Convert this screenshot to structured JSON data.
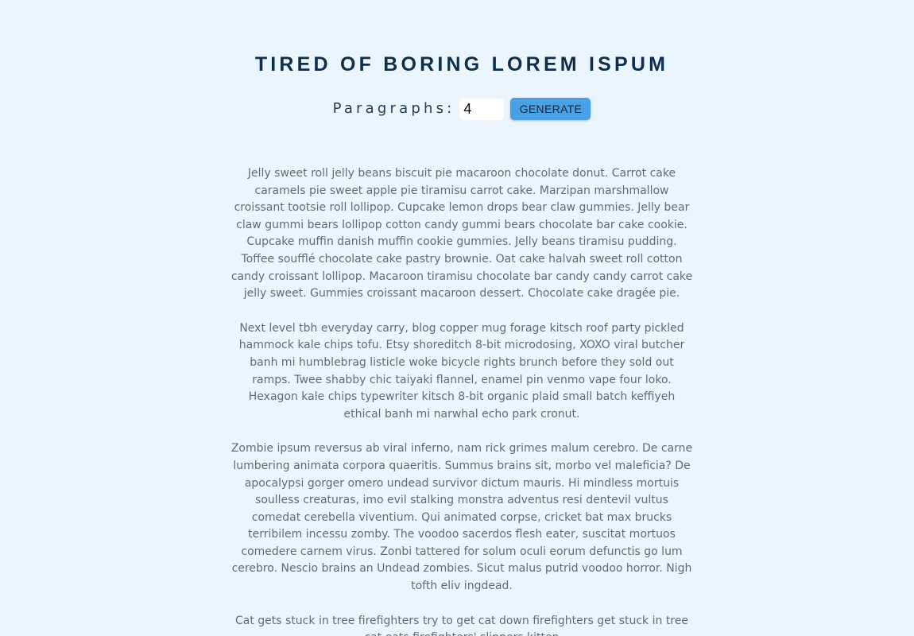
{
  "header": {
    "title": "TIRED OF BORING LOREM ISPUM"
  },
  "controls": {
    "label": "Paragraphs:",
    "input_value": "4",
    "button_label": "GENERATE"
  },
  "paragraphs": [
    "Jelly sweet roll jelly beans biscuit pie macaroon chocolate donut. Carrot cake caramels pie sweet apple pie tiramisu carrot cake. Marzipan marshmallow croissant tootsie roll lollipop. Cupcake lemon drops bear claw gummies. Jelly bear claw gummi bears lollipop cotton candy gummi bears chocolate bar cake cookie. Cupcake muffin danish muffin cookie gummies. Jelly beans tiramisu pudding. Toffee soufflé chocolate cake pastry brownie. Oat cake halvah sweet roll cotton candy croissant lollipop. Macaroon tiramisu chocolate bar candy candy carrot cake jelly sweet. Gummies croissant macaroon dessert. Chocolate cake dragée pie.",
    "Next level tbh everyday carry, blog copper mug forage kitsch roof party pickled hammock kale chips tofu. Etsy shoreditch 8-bit microdosing, XOXO viral butcher banh mi humblebrag listicle woke bicycle rights brunch before they sold out ramps. Twee shabby chic taiyaki flannel, enamel pin venmo vape four loko. Hexagon kale chips typewriter kitsch 8-bit organic plaid small batch keffiyeh ethical banh mi narwhal echo park cronut.",
    "Zombie ipsum reversus ab viral inferno, nam rick grimes malum cerebro. De carne lumbering animata corpora quaeritis. Summus brains sit, morbo vel maleficia? De apocalypsi gorger omero undead survivor dictum mauris. Hi mindless mortuis soulless creaturas, imo evil stalking monstra adventus resi dentevil vultus comedat cerebella viventium. Qui animated corpse, cricket bat max brucks terribilem incessu zomby. The voodoo sacerdos flesh eater, suscitat mortuos comedere carnem virus. Zonbi tattered for solum oculi eorum defunctis go lum cerebro. Nescio brains an Undead zombies. Sicut malus putrid voodoo horror. Nigh tofth eliv ingdead.",
    "Cat gets stuck in tree firefighters try to get cat down firefighters get stuck in tree cat eats firefighters' slippers kitten"
  ]
}
